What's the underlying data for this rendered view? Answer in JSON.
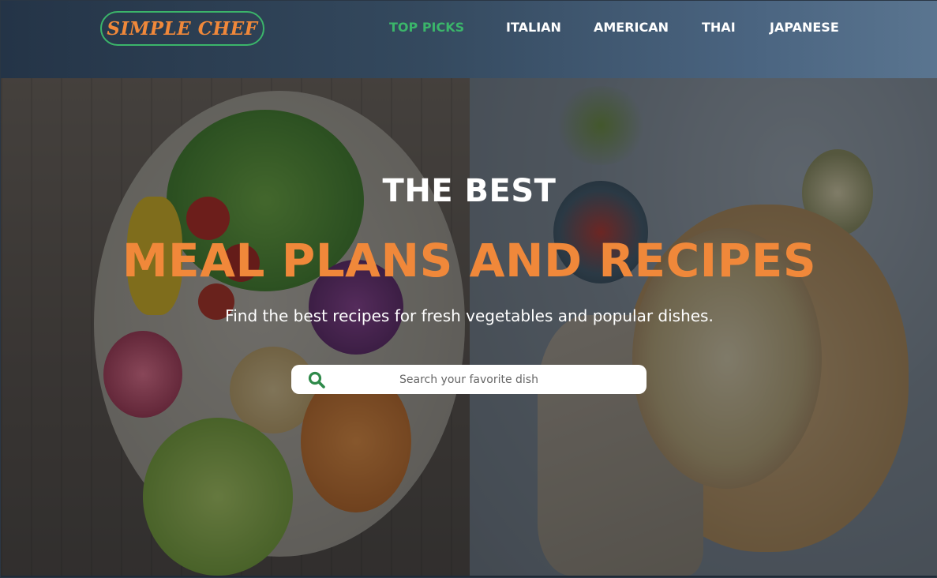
{
  "brand": {
    "logo_text": "SIMPLE CHEF",
    "accent_color": "#3bb56a",
    "highlight_color": "#f0883a"
  },
  "nav": {
    "items": [
      {
        "label": "TOP PICKS",
        "active": true
      },
      {
        "label": "ITALIAN",
        "active": false
      },
      {
        "label": "AMERICAN",
        "active": false
      },
      {
        "label": "THAI",
        "active": false
      },
      {
        "label": "JAPANESE",
        "active": false
      }
    ]
  },
  "hero": {
    "kicker": "THE BEST",
    "title": "MEAL PLANS AND RECIPES",
    "subtitle": "Find the best recipes for fresh vegetables and popular dishes."
  },
  "search": {
    "placeholder": "Search your favorite dish",
    "value": "",
    "icon": "search-icon"
  }
}
